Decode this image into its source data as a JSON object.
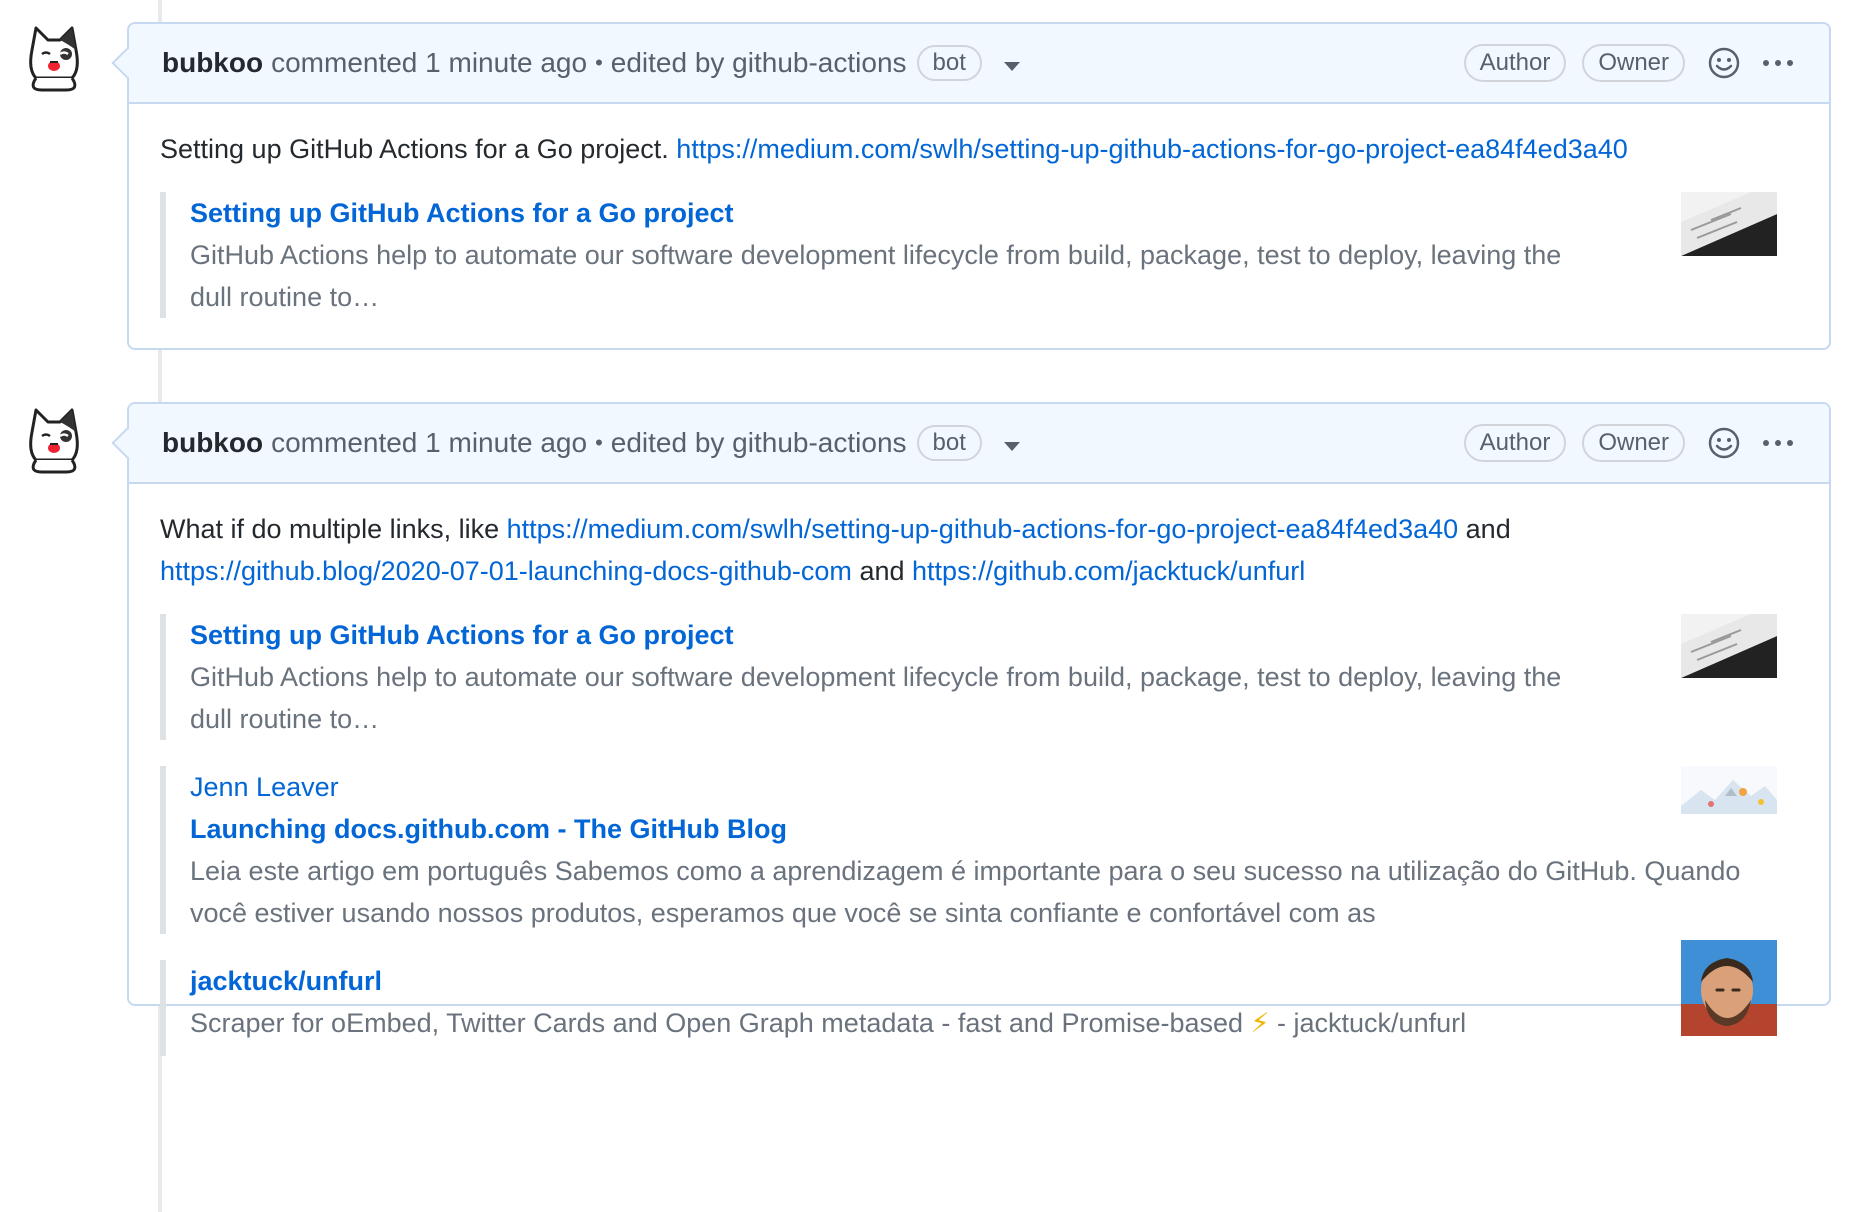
{
  "comments": [
    {
      "author": "bubkoo",
      "meta": "commented 1 minute ago",
      "edited": "edited by github-actions",
      "bot_badge": "bot",
      "badges": [
        "Author",
        "Owner"
      ],
      "body_text": "Setting up GitHub Actions for a Go project.",
      "body_link": "https://medium.com/swlh/setting-up-github-actions-for-go-project-ea84f4ed3a40",
      "unfurls": [
        {
          "title": "Setting up GitHub Actions for a Go project",
          "description": "GitHub Actions help to automate our software development lifecycle from build, package, test to deploy, leaving the dull routine to…"
        }
      ]
    },
    {
      "author": "bubkoo",
      "meta": "commented 1 minute ago",
      "edited": "edited by github-actions",
      "bot_badge": "bot",
      "badges": [
        "Author",
        "Owner"
      ],
      "body_prefix": "What if do multiple links, like",
      "links": [
        "https://medium.com/swlh/setting-up-github-actions-for-go-project-ea84f4ed3a40",
        "https://github.blog/2020-07-01-launching-docs-github-com",
        "https://github.com/jacktuck/unfurl"
      ],
      "conj": "and",
      "unfurls": [
        {
          "title": "Setting up GitHub Actions for a Go project",
          "description": "GitHub Actions help to automate our software development lifecycle from build, package, test to deploy, leaving the dull routine to…"
        },
        {
          "author": "Jenn Leaver",
          "title": "Launching docs.github.com - The GitHub Blog",
          "description": "Leia este artigo em português Sabemos como a aprendizagem é importante para o seu sucesso na utilização do GitHub. Quando você estiver usando nossos produtos, esperamos que você se sinta confiante e confortável com as"
        },
        {
          "title": "jacktuck/unfurl",
          "description_before": "Scraper for oEmbed, Twitter Cards and Open Graph metadata - fast and Promise-based",
          "description_emoji": "⚡",
          "description_after": "- jacktuck/unfurl"
        }
      ]
    }
  ]
}
